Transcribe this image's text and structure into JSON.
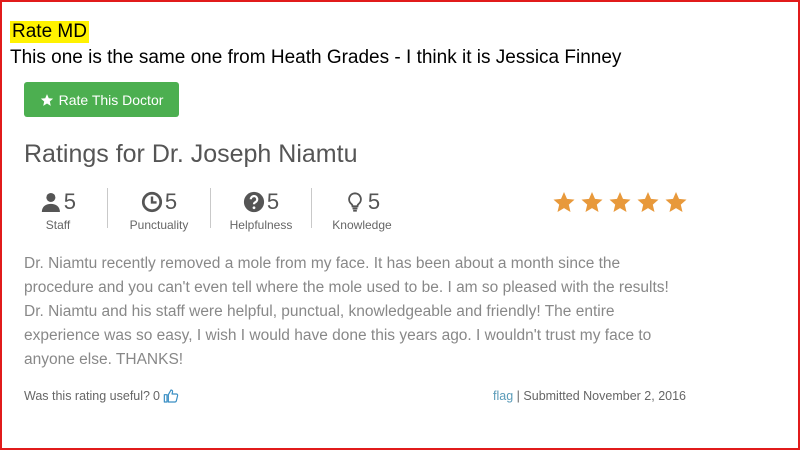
{
  "annotation": {
    "title": "Rate MD",
    "note": "This one is the same one from Heath Grades -  I think it is Jessica Finney"
  },
  "rate_button": {
    "label": "Rate This Doctor",
    "icon": "star-icon"
  },
  "heading": "Ratings for Dr. Joseph Niamtu",
  "metrics": [
    {
      "value": "5",
      "label": "Staff",
      "icon": "user-icon"
    },
    {
      "value": "5",
      "label": "Punctuality",
      "icon": "clock-icon"
    },
    {
      "value": "5",
      "label": "Helpfulness",
      "icon": "question-icon"
    },
    {
      "value": "5",
      "label": "Knowledge",
      "icon": "lightbulb-icon"
    }
  ],
  "overall_rating": {
    "stars": 5,
    "max": 5,
    "color": "#e8993b"
  },
  "review_text": "Dr. Niamtu recently removed a mole from my face. It has been about a month since the procedure and you can't even tell where the mole used to be. I am so pleased with the results! Dr. Niamtu and his staff were helpful, punctual, knowledgeable and friendly! The entire experience was so easy, I wish I would have done this years ago. I wouldn't trust my face to anyone else. THANKS!",
  "footer": {
    "useful_label": "Was this rating useful?",
    "useful_count": "0",
    "flag_label": "flag",
    "separator": "|",
    "submitted": "Submitted November 2, 2016"
  },
  "colors": {
    "frame": "#e11b1b",
    "highlight": "#fff200",
    "button": "#4caf50",
    "link": "#5a9bb8"
  }
}
